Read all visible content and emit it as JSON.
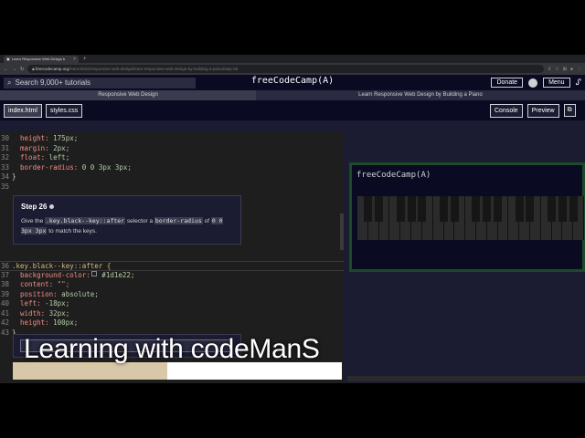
{
  "browser": {
    "tab_title": "Learn Responsive Web Design b",
    "new_tab": "+",
    "url_host": "freecodecamp.org",
    "url_path": "/learn/2022/responsive-web-design/learn-responsive-web-design-by-building-a-piano/step-26"
  },
  "nav": {
    "search_placeholder": "Search 9,000+ tutorials",
    "logo": "freeCodeCamp(A)",
    "donate": "Donate",
    "menu": "Menu"
  },
  "breadcrumb": {
    "course": "Responsive Web Design",
    "project": "Learn Responsive Web Design by Building a Piano"
  },
  "tabs": {
    "html": "index.html",
    "css": "styles.css",
    "console": "Console",
    "preview": "Preview"
  },
  "code_top": [
    {
      "n": "30",
      "prop": "height:",
      "val": " 175px;"
    },
    {
      "n": "31",
      "prop": "margin:",
      "val": " 2px;"
    },
    {
      "n": "32",
      "prop": "float:",
      "val": " left;"
    },
    {
      "n": "33",
      "prop": "border-radius:",
      "val": " 0 0 3px 3px;"
    },
    {
      "n": "34",
      "brace": "}"
    },
    {
      "n": "35",
      "brace": ""
    }
  ],
  "step": {
    "title": "Step 26",
    "desc_1": "Give the ",
    "code_1": ".key.black--key::after",
    "desc_2": " selector a ",
    "code_2": "border-radius",
    "desc_3": " of ",
    "code_3": "0 0 3px 3px",
    "desc_4": " to match the keys."
  },
  "code_bottom": [
    {
      "n": "36",
      "sel": ".key.black--key::after {"
    },
    {
      "n": "37",
      "prop": "background-color:",
      "val": " #1d1e22;",
      "swatch": true
    },
    {
      "n": "38",
      "prop": "content:",
      "str": " \"\";"
    },
    {
      "n": "39",
      "prop": "position:",
      "val": " absolute;"
    },
    {
      "n": "40",
      "prop": "left:",
      "val": " -18px;"
    },
    {
      "n": "41",
      "prop": "width:",
      "val": " 32px;"
    },
    {
      "n": "42",
      "prop": "height:",
      "val": " 100px;"
    },
    {
      "n": "43",
      "brace": "}"
    }
  ],
  "preview": {
    "logo": "freeCodeCamp(A)"
  },
  "caption": "Learning with codeManS",
  "video_progress": 0.47,
  "colors": {
    "accent_green": "#1b4b27",
    "fcc_dark": "#0a0a23"
  }
}
